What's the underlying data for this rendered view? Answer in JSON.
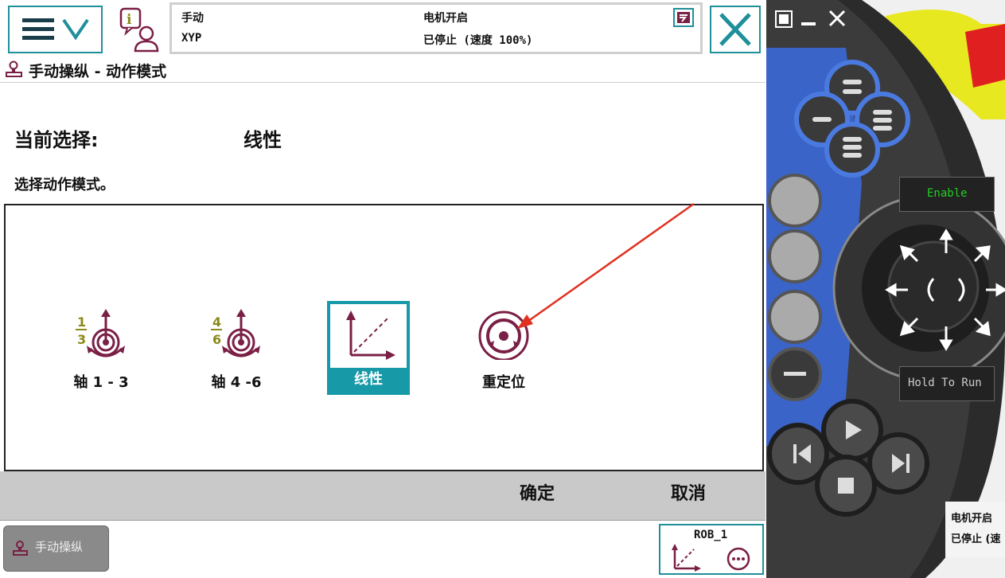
{
  "status": {
    "mode": "手动",
    "system": "XYP",
    "motor": "电机开启",
    "state": "已停止 (速度 100%)"
  },
  "header": {
    "title": "手动操纵 - 动作模式"
  },
  "selection": {
    "current_label": "当前选择:",
    "current_value": "线性",
    "instruction": "选择动作模式。"
  },
  "options": [
    {
      "label": "轴 1 - 3",
      "icon": "axis-1-3-icon",
      "selected": false
    },
    {
      "label": "轴 4 -6",
      "icon": "axis-4-6-icon",
      "selected": false
    },
    {
      "label": "线性",
      "icon": "linear-icon",
      "selected": true
    },
    {
      "label": "重定位",
      "icon": "reorient-icon",
      "selected": false
    }
  ],
  "actions": {
    "ok": "确定",
    "cancel": "取消"
  },
  "taskbar": {
    "item": "手动操纵",
    "robot": "ROB_1"
  },
  "pendant": {
    "enable": "Enable",
    "hold_to_run": "Hold To Run",
    "bg_motor": "电机开启",
    "bg_state": "已停止 (速"
  },
  "colors": {
    "teal": "#1f8f9a",
    "selected": "#1899a8",
    "maroon": "#7a1f45",
    "olive": "#8a8a1a",
    "annotation_arrow": "#e03020"
  }
}
